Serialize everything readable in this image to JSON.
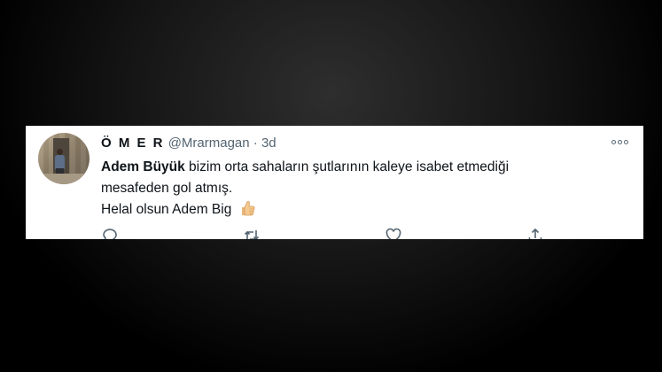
{
  "tweet": {
    "author_name": "Ö M E R",
    "handle": "@Mrarmagan",
    "separator": "·",
    "time": "3d",
    "text": {
      "mention": "Adem Büyük",
      "line1_rest": " bizim orta sahaların şutlarının kaleye isabet etmediği",
      "line2": "mesafeden gol atmış.",
      "line3": "Helal olsun Adem Big"
    },
    "emoji": "thumbs-up-icon",
    "actions": [
      "reply-icon",
      "retweet-icon",
      "like-icon",
      "share-icon"
    ]
  },
  "colors": {
    "text": "#0f1419",
    "secondary": "#536471",
    "card": "#ffffff",
    "background": "#000000"
  }
}
